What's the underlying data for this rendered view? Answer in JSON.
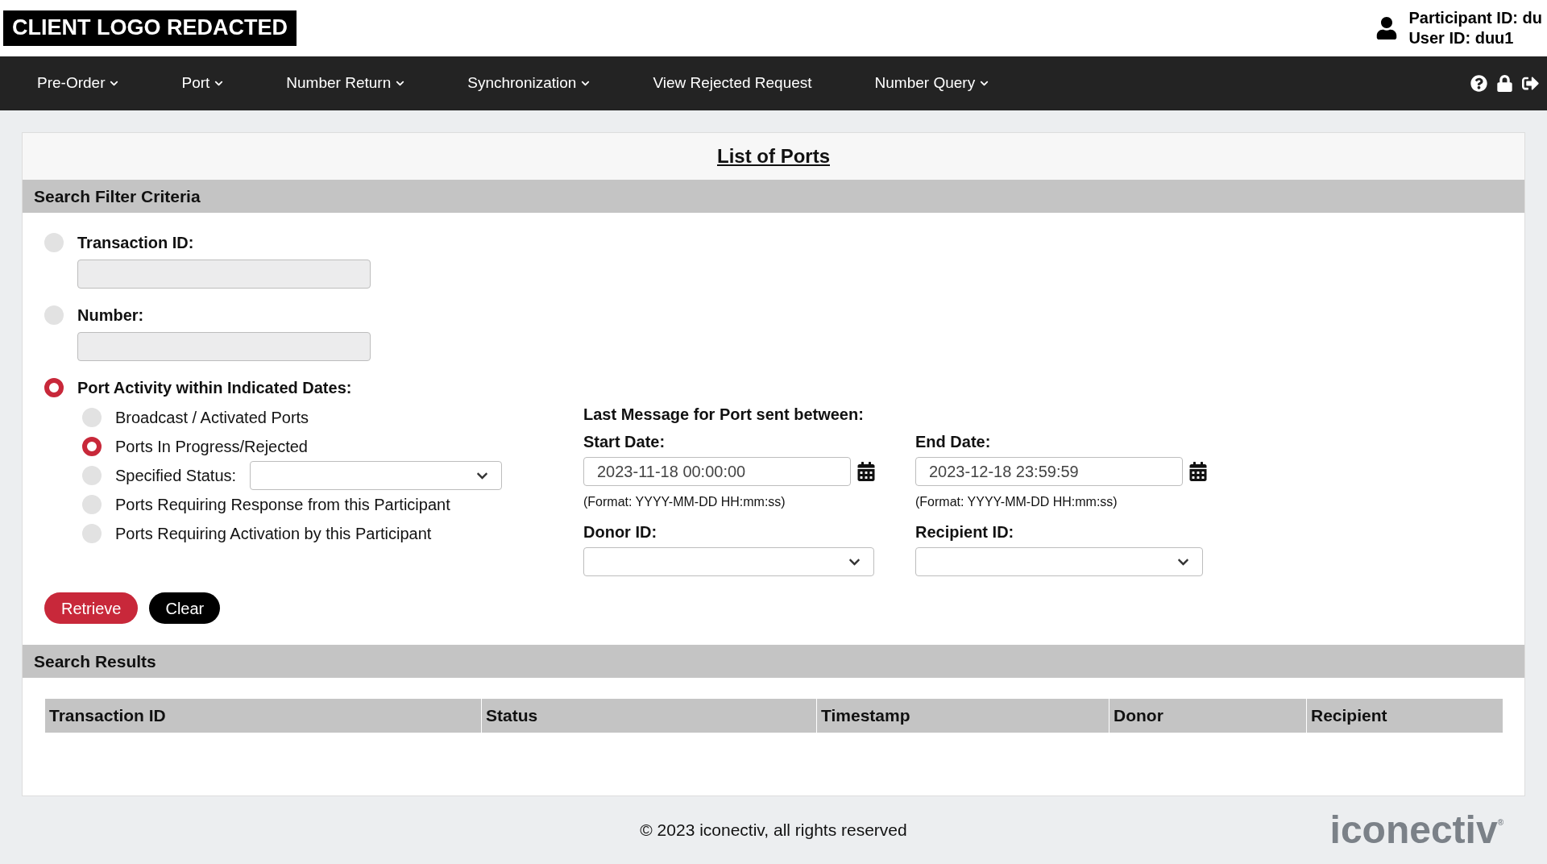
{
  "header": {
    "logo": "CLIENT LOGO REDACTED",
    "participant_id": "Participant ID: du",
    "user_id": "User ID: duu1"
  },
  "nav": {
    "items": [
      {
        "label": "Pre-Order",
        "dropdown": true
      },
      {
        "label": "Port",
        "dropdown": true
      },
      {
        "label": "Number Return",
        "dropdown": true
      },
      {
        "label": "Synchronization",
        "dropdown": true
      },
      {
        "label": "View Rejected Request",
        "dropdown": false
      },
      {
        "label": "Number Query",
        "dropdown": true
      }
    ]
  },
  "page_title": "List of Ports",
  "filter": {
    "title": "Search Filter Criteria",
    "options": [
      {
        "label": "Transaction ID:",
        "selected": false,
        "kind": "text"
      },
      {
        "label": "Number:",
        "selected": false,
        "kind": "text"
      },
      {
        "label": "Port Activity within Indicated Dates:",
        "selected": true,
        "kind": "group"
      }
    ],
    "sub_options": [
      {
        "label": "Broadcast / Activated Ports",
        "selected": false,
        "kind": "plain"
      },
      {
        "label": "Ports In Progress/Rejected",
        "selected": true,
        "kind": "plain"
      },
      {
        "label": "Specified Status:",
        "selected": false,
        "kind": "select"
      },
      {
        "label": "Ports Requiring Response from this Participant",
        "selected": false,
        "kind": "plain"
      },
      {
        "label": "Ports Requiring Activation by this Participant",
        "selected": false,
        "kind": "plain"
      }
    ],
    "dates": {
      "heading": "Last Message for Port sent between:",
      "start": {
        "label": "Start Date:",
        "value": "2023-11-18 00:00:00",
        "format": "(Format: YYYY-MM-DD HH:mm:ss)"
      },
      "end": {
        "label": "End Date:",
        "value": "2023-12-18 23:59:59",
        "format": "(Format: YYYY-MM-DD HH:mm:ss)"
      },
      "donor": {
        "label": "Donor ID:"
      },
      "recipient": {
        "label": "Recipient ID:"
      }
    },
    "buttons": [
      {
        "label": "Retrieve",
        "kind": "primary"
      },
      {
        "label": "Clear",
        "kind": "secondary"
      }
    ]
  },
  "results": {
    "title": "Search Results",
    "columns": [
      "Transaction ID",
      "Status",
      "Timestamp",
      "Donor",
      "Recipient"
    ]
  },
  "footer": {
    "copyright": "© 2023 iconectiv, all rights reserved",
    "brand": "iconectiv",
    "brand_mark": "®"
  }
}
